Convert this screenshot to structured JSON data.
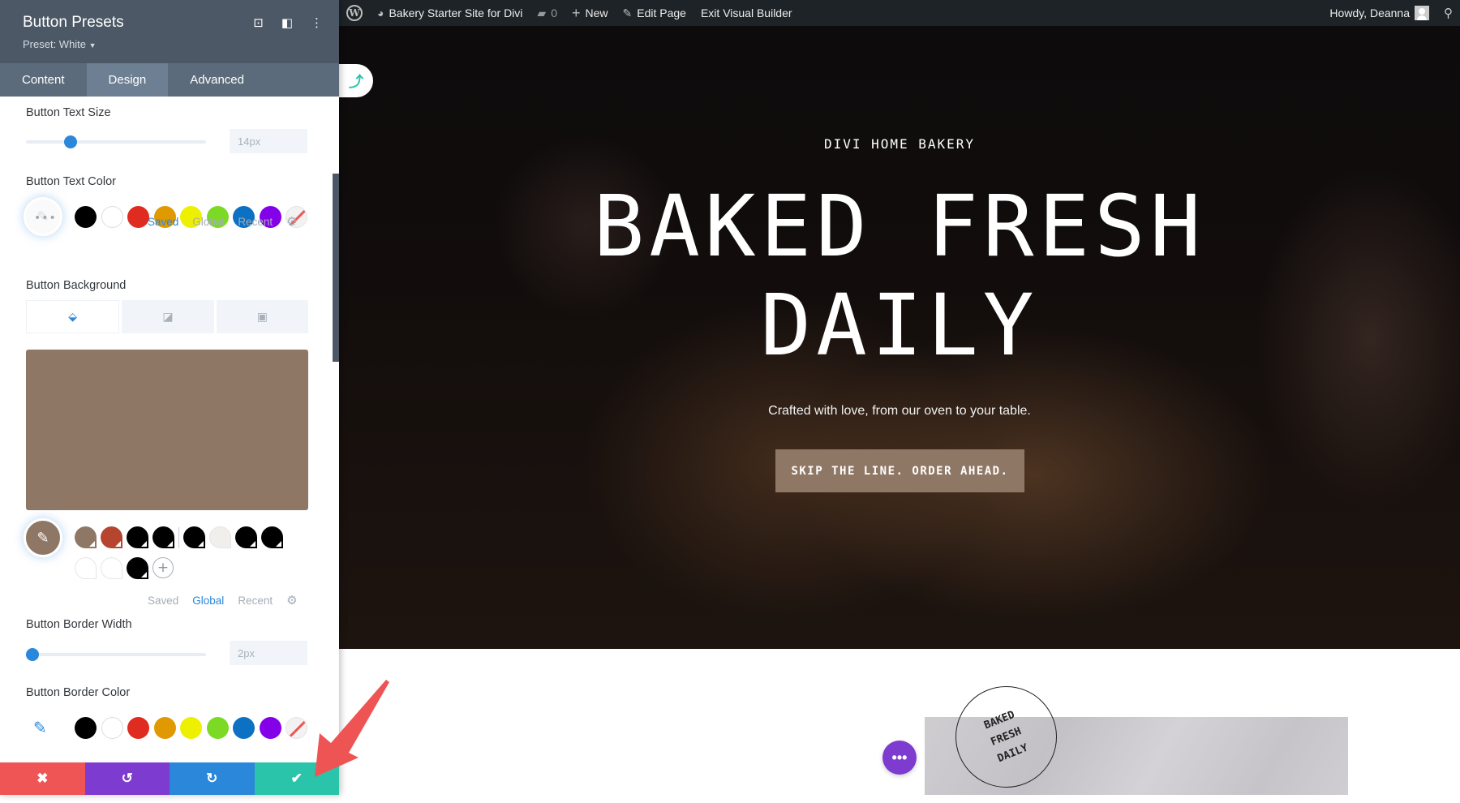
{
  "admin_bar": {
    "site_name": "Bakery Starter Site for Divi",
    "comments_count": "0",
    "new_label": "New",
    "edit_page_label": "Edit Page",
    "exit_builder_label": "Exit Visual Builder",
    "greeting": "Howdy, Deanna",
    "icons": {
      "wordpress": "wordpress-logo-icon",
      "dashboard": "dashboard-icon",
      "comments": "comment-bubble-icon",
      "new": "plus-icon",
      "edit": "pencil-icon",
      "search": "search-icon"
    }
  },
  "panel": {
    "title": "Button Presets",
    "preset": "Preset: White",
    "tabs": [
      {
        "label": "Content",
        "active": false
      },
      {
        "label": "Design",
        "active": true
      },
      {
        "label": "Advanced",
        "active": false
      }
    ],
    "text_size": {
      "label": "Button Text Size",
      "value": "14px",
      "fraction": 0.14
    },
    "text_color": {
      "label": "Button Text Color",
      "swatches": [
        "#000000",
        "#ffffff",
        "#e02b20",
        "#e09900",
        "#edf000",
        "#7cda24",
        "#0c71c3",
        "#8300e9",
        "none"
      ],
      "palette_tabs": [
        "Saved",
        "Global",
        "Recent"
      ],
      "active_palette": "Saved"
    },
    "background": {
      "label": "Button Background",
      "tabs": [
        "color",
        "gradient",
        "image"
      ],
      "active_tab": "color",
      "color": "#8f7765",
      "global_swatches": [
        "#8f7765",
        "#b5452f",
        "#000000",
        "#000000",
        "#000000",
        "#f0efec",
        "#000000",
        "#000000",
        "#ffffff",
        "#ffffff",
        "#000000"
      ],
      "palette_tabs": [
        "Saved",
        "Global",
        "Recent"
      ],
      "active_palette": "Global"
    },
    "border_width": {
      "label": "Button Border Width",
      "value": "2px",
      "fraction": 0.0
    },
    "border_color": {
      "label": "Button Border Color",
      "swatches": [
        "#000000",
        "#ffffff",
        "#e02b20",
        "#e09900",
        "#edf000",
        "#7cda24",
        "#0c71c3",
        "#8300e9",
        "none"
      ]
    },
    "footer": {
      "discard": {
        "icon": "✖",
        "color": "#ef5555"
      },
      "undo": {
        "icon": "↺",
        "color": "#7e3bd0"
      },
      "redo": {
        "icon": "↻",
        "color": "#2b87da"
      },
      "save": {
        "icon": "✔",
        "color": "#29c4a9"
      }
    }
  },
  "hero": {
    "eyebrow": "DIVI HOME BAKERY",
    "headline_line1": "BAKED FRESH",
    "headline_line2": "DAILY",
    "subtitle": "Crafted with love, from our oven to your table.",
    "cta": "SKIP THE LINE. ORDER AHEAD."
  },
  "lower": {
    "stamp_lines": [
      "BAKED",
      "FRESH",
      "DAILY"
    ],
    "more_icon": "•••"
  }
}
